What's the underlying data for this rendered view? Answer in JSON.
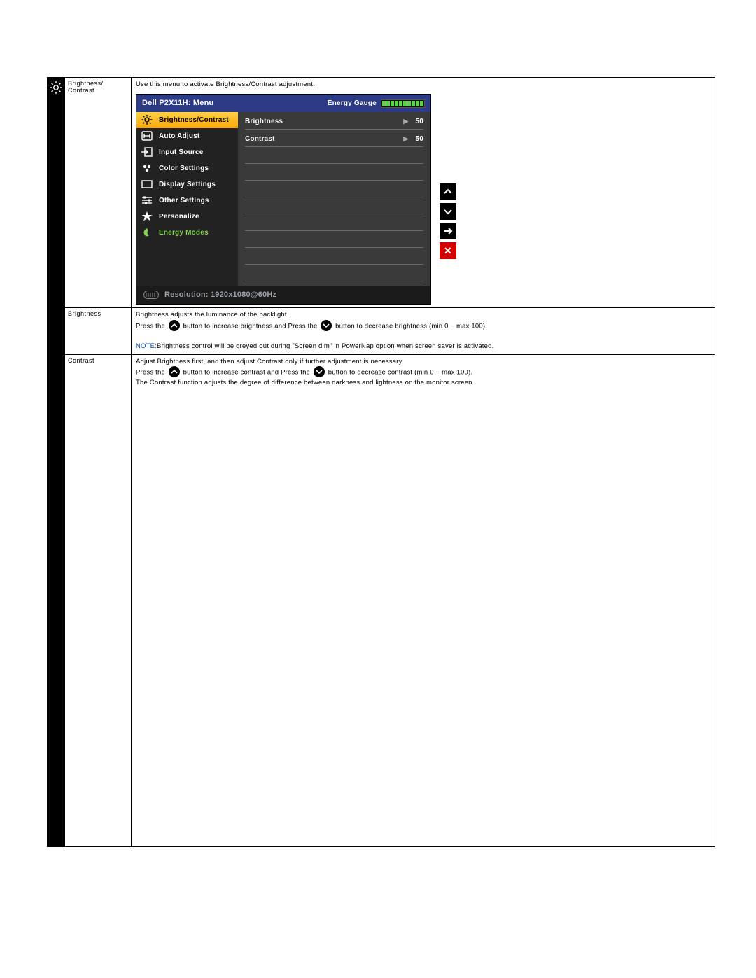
{
  "row1": {
    "label": "Brightness/ Contrast",
    "intro": "Use this menu to activate Brightness/Contrast adjustment."
  },
  "osd": {
    "title": "Dell P2X11H: Menu",
    "gauge_label": "Energy Gauge",
    "gauge_bars": 10,
    "menu": [
      {
        "name": "brightness-contrast",
        "label": "Brightness/Contrast",
        "active": true
      },
      {
        "name": "auto-adjust",
        "label": "Auto Adjust"
      },
      {
        "name": "input-source",
        "label": "Input Source"
      },
      {
        "name": "color-settings",
        "label": "Color Settings"
      },
      {
        "name": "display-settings",
        "label": "Display Settings"
      },
      {
        "name": "other-settings",
        "label": "Other Settings"
      },
      {
        "name": "personalize",
        "label": "Personalize"
      },
      {
        "name": "energy-modes",
        "label": "Energy Modes",
        "green": true
      }
    ],
    "values": [
      {
        "name": "brightness",
        "label": "Brightness",
        "value": "50"
      },
      {
        "name": "contrast",
        "label": "Contrast",
        "value": "50"
      }
    ],
    "footer": "Resolution: 1920x1080@60Hz"
  },
  "side_buttons": {
    "up": "up",
    "down": "down",
    "enter": "enter",
    "close": "close",
    "close_glyph": "✕"
  },
  "row2": {
    "label": "Brightness",
    "line1": "Brightness adjusts the luminance of the backlight.",
    "press_the": "Press the ",
    "b_up_after": " button to increase brightness and Press the ",
    "b_down_after": " button to decrease brightness (min 0 ~ max 100).",
    "note_label": "NOTE:",
    "note_text": "Brightness control will be greyed out during \"Screen dim\" in PowerNap option when screen saver is activated."
  },
  "row3": {
    "label": "Contrast",
    "line1": "Adjust Brightness first, and then adjust Contrast only if further adjustment is necessary.",
    "press_the": "Press the ",
    "c_up_after": " button to increase contrast and Press the ",
    "c_down_after": " button to decrease contrast (min 0 ~ max 100).",
    "line3": "The Contrast function adjusts the degree of difference between darkness and lightness on the monitor screen."
  }
}
